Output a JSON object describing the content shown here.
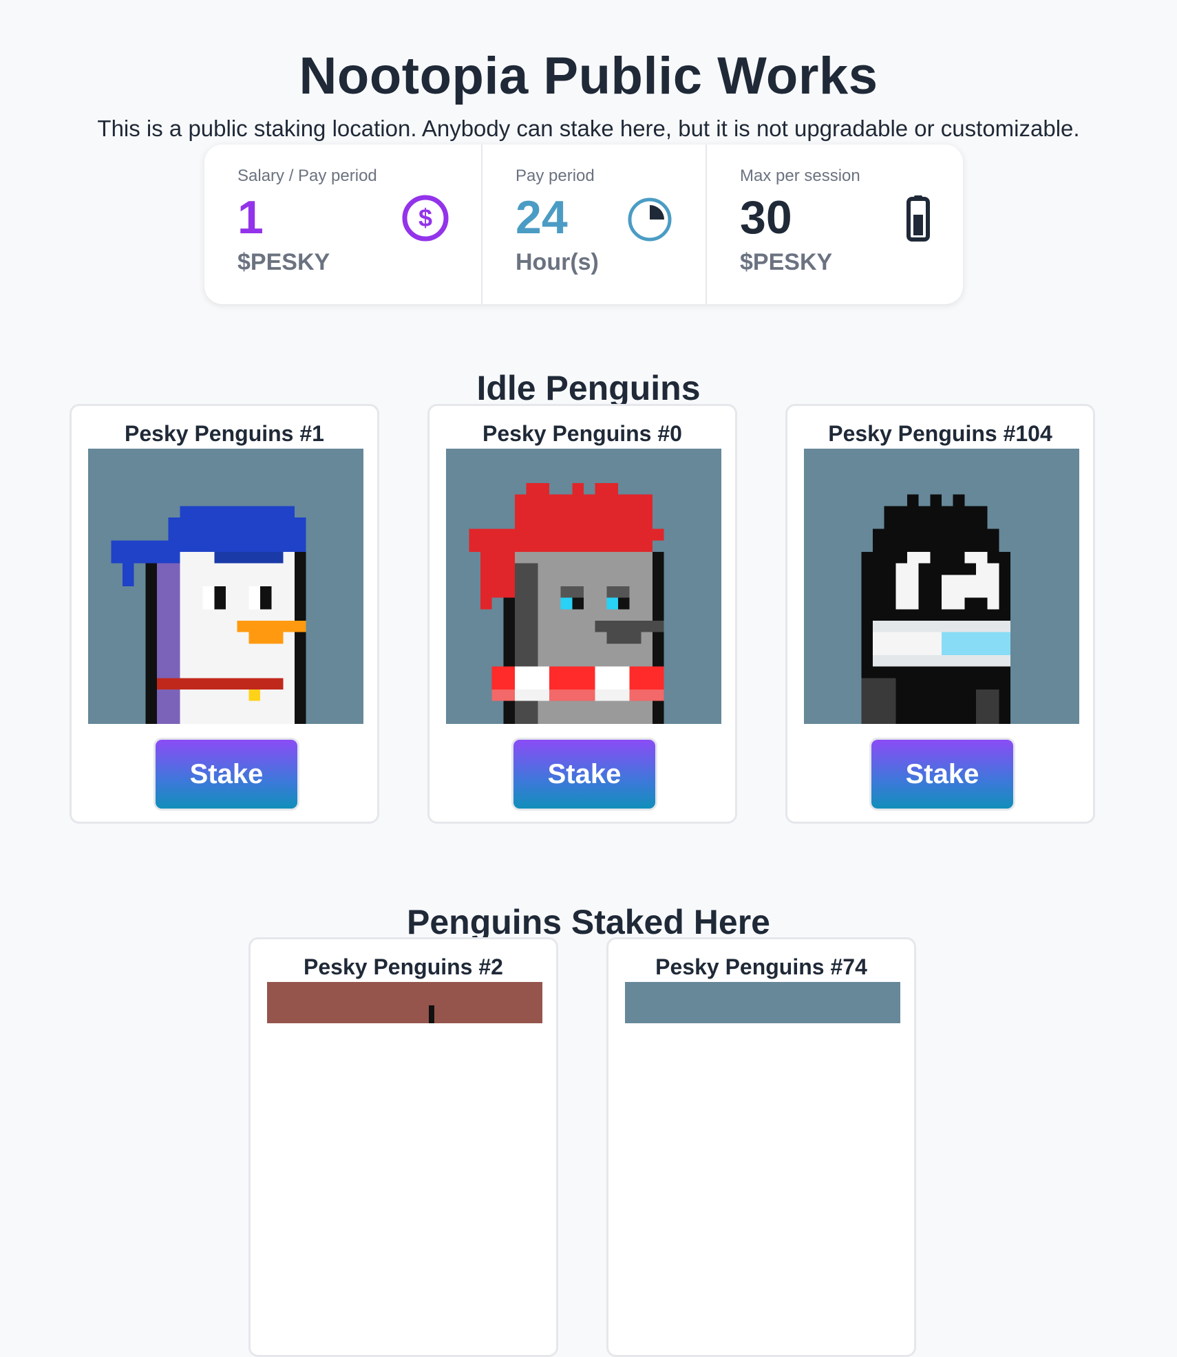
{
  "header": {
    "title": "Nootopia Public Works",
    "subtitle": "This is a public staking location. Anybody can stake here, but it is not upgradable or customizable."
  },
  "stats": [
    {
      "label": "Salary / Pay period",
      "value": "1",
      "unit": "$PESKY",
      "icon": "dollar-circle-icon",
      "color": "#9333ea"
    },
    {
      "label": "Pay period",
      "value": "24",
      "unit": "Hour(s)",
      "icon": "clock-icon",
      "color": "#4b9cc4"
    },
    {
      "label": "Max per session",
      "value": "30",
      "unit": "$PESKY",
      "icon": "battery-icon",
      "color": "#1f2937"
    }
  ],
  "idle_section": {
    "title": "Idle Penguins",
    "cards": [
      {
        "name": "Pesky Penguins #1",
        "button": "Stake"
      },
      {
        "name": "Pesky Penguins #0",
        "button": "Stake"
      },
      {
        "name": "Pesky Penguins #104",
        "button": "Stake"
      }
    ]
  },
  "staked_section": {
    "title": "Penguins Staked Here",
    "cards": [
      {
        "name": "Pesky Penguins #2"
      },
      {
        "name": "Pesky Penguins #74"
      }
    ]
  },
  "colors": {
    "accent_purple": "#8b4cf6",
    "accent_teal": "#118fba",
    "card_bg_blue_gray": "#668899",
    "card_bg_brown": "#95554c"
  }
}
